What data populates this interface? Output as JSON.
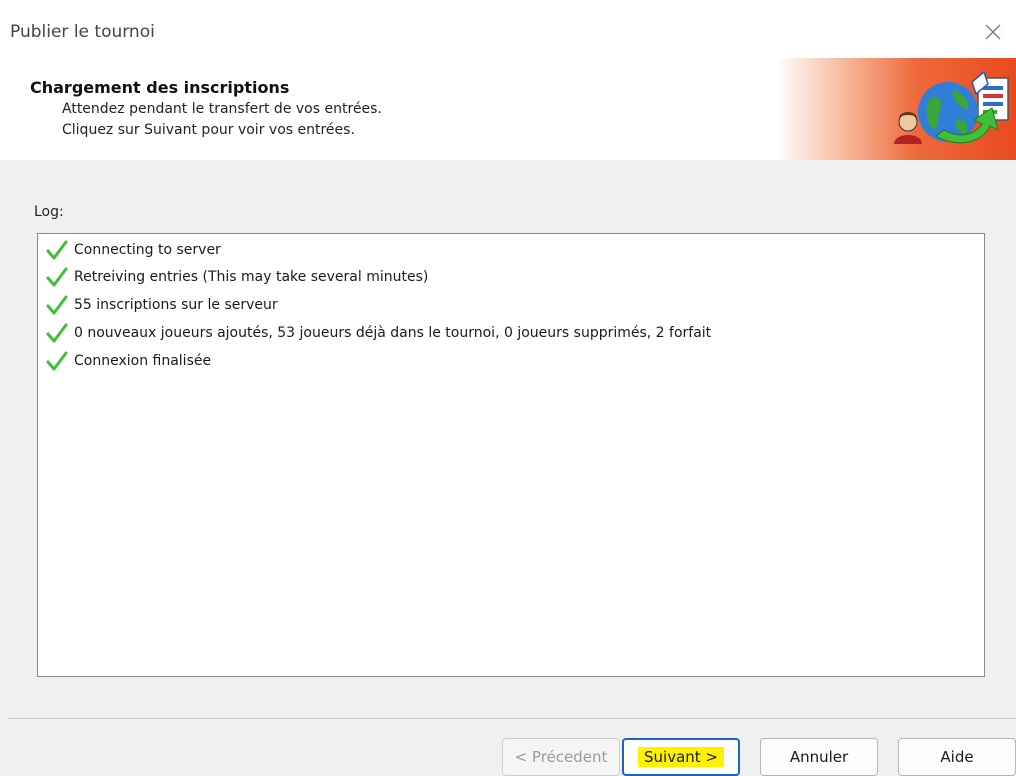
{
  "window": {
    "title": "Publier le tournoi",
    "close_icon": "close-icon"
  },
  "header": {
    "title": "Chargement des inscriptions",
    "line1": "Attendez pendant le transfert de vos entrées.",
    "line2": "Cliquez sur Suivant pour voir vos entrées.",
    "graphic_icon": "globe-publish-icon",
    "gradient_colors": [
      "#f6b597",
      "#ee6a3c",
      "#e94a1e"
    ]
  },
  "log": {
    "label": "Log:",
    "items": [
      {
        "icon": "check-icon",
        "text": "Connecting to server"
      },
      {
        "icon": "check-icon",
        "text": "Retreiving entries (This may take several minutes)"
      },
      {
        "icon": "check-icon",
        "text": "55 inscriptions sur le serveur"
      },
      {
        "icon": "check-icon",
        "text": "0 nouveaux joueurs ajoutés, 53 joueurs déjà dans le tournoi, 0 joueurs supprimés, 2 forfait"
      },
      {
        "icon": "check-icon",
        "text": "Connexion finalisée"
      }
    ],
    "check_color": "#3fbf3a"
  },
  "buttons": {
    "previous": "< Précedent",
    "next": "Suivant >",
    "cancel": "Annuler",
    "help": "Aide",
    "highlight_color": "#fff200",
    "focus_border_color": "#1f63c7"
  }
}
